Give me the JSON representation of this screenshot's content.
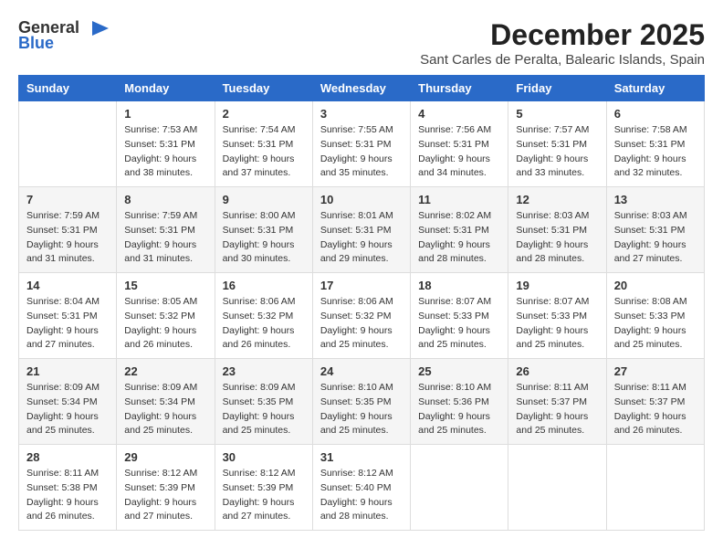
{
  "logo": {
    "general": "General",
    "blue": "Blue"
  },
  "title": "December 2025",
  "location": "Sant Carles de Peralta, Balearic Islands, Spain",
  "days_of_week": [
    "Sunday",
    "Monday",
    "Tuesday",
    "Wednesday",
    "Thursday",
    "Friday",
    "Saturday"
  ],
  "weeks": [
    [
      {
        "day": "",
        "sunrise": "",
        "sunset": "",
        "daylight": ""
      },
      {
        "day": "1",
        "sunrise": "Sunrise: 7:53 AM",
        "sunset": "Sunset: 5:31 PM",
        "daylight": "Daylight: 9 hours and 38 minutes."
      },
      {
        "day": "2",
        "sunrise": "Sunrise: 7:54 AM",
        "sunset": "Sunset: 5:31 PM",
        "daylight": "Daylight: 9 hours and 37 minutes."
      },
      {
        "day": "3",
        "sunrise": "Sunrise: 7:55 AM",
        "sunset": "Sunset: 5:31 PM",
        "daylight": "Daylight: 9 hours and 35 minutes."
      },
      {
        "day": "4",
        "sunrise": "Sunrise: 7:56 AM",
        "sunset": "Sunset: 5:31 PM",
        "daylight": "Daylight: 9 hours and 34 minutes."
      },
      {
        "day": "5",
        "sunrise": "Sunrise: 7:57 AM",
        "sunset": "Sunset: 5:31 PM",
        "daylight": "Daylight: 9 hours and 33 minutes."
      },
      {
        "day": "6",
        "sunrise": "Sunrise: 7:58 AM",
        "sunset": "Sunset: 5:31 PM",
        "daylight": "Daylight: 9 hours and 32 minutes."
      }
    ],
    [
      {
        "day": "7",
        "sunrise": "Sunrise: 7:59 AM",
        "sunset": "Sunset: 5:31 PM",
        "daylight": "Daylight: 9 hours and 31 minutes."
      },
      {
        "day": "8",
        "sunrise": "Sunrise: 7:59 AM",
        "sunset": "Sunset: 5:31 PM",
        "daylight": "Daylight: 9 hours and 31 minutes."
      },
      {
        "day": "9",
        "sunrise": "Sunrise: 8:00 AM",
        "sunset": "Sunset: 5:31 PM",
        "daylight": "Daylight: 9 hours and 30 minutes."
      },
      {
        "day": "10",
        "sunrise": "Sunrise: 8:01 AM",
        "sunset": "Sunset: 5:31 PM",
        "daylight": "Daylight: 9 hours and 29 minutes."
      },
      {
        "day": "11",
        "sunrise": "Sunrise: 8:02 AM",
        "sunset": "Sunset: 5:31 PM",
        "daylight": "Daylight: 9 hours and 28 minutes."
      },
      {
        "day": "12",
        "sunrise": "Sunrise: 8:03 AM",
        "sunset": "Sunset: 5:31 PM",
        "daylight": "Daylight: 9 hours and 28 minutes."
      },
      {
        "day": "13",
        "sunrise": "Sunrise: 8:03 AM",
        "sunset": "Sunset: 5:31 PM",
        "daylight": "Daylight: 9 hours and 27 minutes."
      }
    ],
    [
      {
        "day": "14",
        "sunrise": "Sunrise: 8:04 AM",
        "sunset": "Sunset: 5:31 PM",
        "daylight": "Daylight: 9 hours and 27 minutes."
      },
      {
        "day": "15",
        "sunrise": "Sunrise: 8:05 AM",
        "sunset": "Sunset: 5:32 PM",
        "daylight": "Daylight: 9 hours and 26 minutes."
      },
      {
        "day": "16",
        "sunrise": "Sunrise: 8:06 AM",
        "sunset": "Sunset: 5:32 PM",
        "daylight": "Daylight: 9 hours and 26 minutes."
      },
      {
        "day": "17",
        "sunrise": "Sunrise: 8:06 AM",
        "sunset": "Sunset: 5:32 PM",
        "daylight": "Daylight: 9 hours and 25 minutes."
      },
      {
        "day": "18",
        "sunrise": "Sunrise: 8:07 AM",
        "sunset": "Sunset: 5:33 PM",
        "daylight": "Daylight: 9 hours and 25 minutes."
      },
      {
        "day": "19",
        "sunrise": "Sunrise: 8:07 AM",
        "sunset": "Sunset: 5:33 PM",
        "daylight": "Daylight: 9 hours and 25 minutes."
      },
      {
        "day": "20",
        "sunrise": "Sunrise: 8:08 AM",
        "sunset": "Sunset: 5:33 PM",
        "daylight": "Daylight: 9 hours and 25 minutes."
      }
    ],
    [
      {
        "day": "21",
        "sunrise": "Sunrise: 8:09 AM",
        "sunset": "Sunset: 5:34 PM",
        "daylight": "Daylight: 9 hours and 25 minutes."
      },
      {
        "day": "22",
        "sunrise": "Sunrise: 8:09 AM",
        "sunset": "Sunset: 5:34 PM",
        "daylight": "Daylight: 9 hours and 25 minutes."
      },
      {
        "day": "23",
        "sunrise": "Sunrise: 8:09 AM",
        "sunset": "Sunset: 5:35 PM",
        "daylight": "Daylight: 9 hours and 25 minutes."
      },
      {
        "day": "24",
        "sunrise": "Sunrise: 8:10 AM",
        "sunset": "Sunset: 5:35 PM",
        "daylight": "Daylight: 9 hours and 25 minutes."
      },
      {
        "day": "25",
        "sunrise": "Sunrise: 8:10 AM",
        "sunset": "Sunset: 5:36 PM",
        "daylight": "Daylight: 9 hours and 25 minutes."
      },
      {
        "day": "26",
        "sunrise": "Sunrise: 8:11 AM",
        "sunset": "Sunset: 5:37 PM",
        "daylight": "Daylight: 9 hours and 25 minutes."
      },
      {
        "day": "27",
        "sunrise": "Sunrise: 8:11 AM",
        "sunset": "Sunset: 5:37 PM",
        "daylight": "Daylight: 9 hours and 26 minutes."
      }
    ],
    [
      {
        "day": "28",
        "sunrise": "Sunrise: 8:11 AM",
        "sunset": "Sunset: 5:38 PM",
        "daylight": "Daylight: 9 hours and 26 minutes."
      },
      {
        "day": "29",
        "sunrise": "Sunrise: 8:12 AM",
        "sunset": "Sunset: 5:39 PM",
        "daylight": "Daylight: 9 hours and 27 minutes."
      },
      {
        "day": "30",
        "sunrise": "Sunrise: 8:12 AM",
        "sunset": "Sunset: 5:39 PM",
        "daylight": "Daylight: 9 hours and 27 minutes."
      },
      {
        "day": "31",
        "sunrise": "Sunrise: 8:12 AM",
        "sunset": "Sunset: 5:40 PM",
        "daylight": "Daylight: 9 hours and 28 minutes."
      },
      {
        "day": "",
        "sunrise": "",
        "sunset": "",
        "daylight": ""
      },
      {
        "day": "",
        "sunrise": "",
        "sunset": "",
        "daylight": ""
      },
      {
        "day": "",
        "sunrise": "",
        "sunset": "",
        "daylight": ""
      }
    ]
  ]
}
